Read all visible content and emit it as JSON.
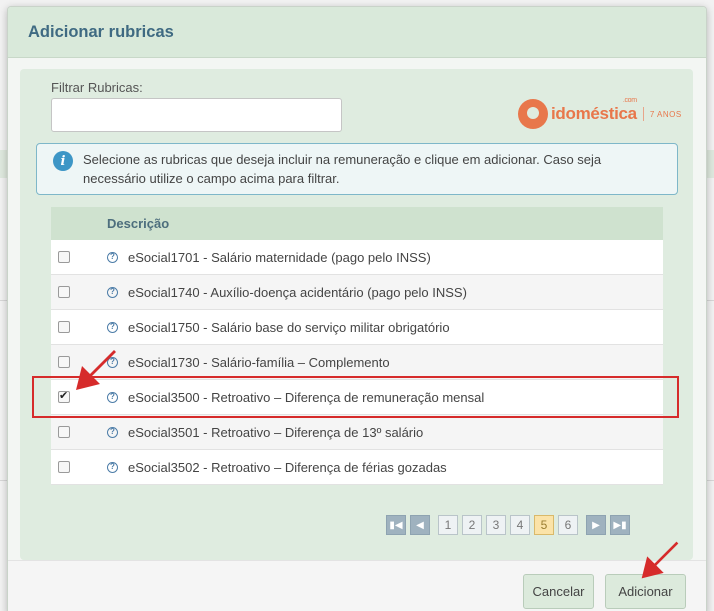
{
  "dialog": {
    "title": "Adicionar rubricas"
  },
  "filter": {
    "label": "Filtrar Rubricas:",
    "value": "",
    "placeholder": ""
  },
  "logo": {
    "brand": "idoméstica",
    "suffix": ".com",
    "tagline": "7 ANOS"
  },
  "info": {
    "message": "Selecione as rubricas que deseja incluir na remuneração e clique em adicionar. Caso seja necessário utilize o campo acima para filtrar."
  },
  "table": {
    "header": "Descrição",
    "rows": [
      {
        "label": "eSocial1701 - Salário maternidade (pago pelo INSS)",
        "checked": false
      },
      {
        "label": "eSocial1740 - Auxílio-doença acidentário (pago pelo INSS)",
        "checked": false
      },
      {
        "label": "eSocial1750 - Salário base do serviço militar obrigatório",
        "checked": false
      },
      {
        "label": "eSocial1730 - Salário-família – Complemento",
        "checked": false
      },
      {
        "label": "eSocial3500 - Retroativo – Diferença de remuneração mensal",
        "checked": true
      },
      {
        "label": "eSocial3501 - Retroativo – Diferença de 13º salário",
        "checked": false
      },
      {
        "label": "eSocial3502 - Retroativo – Diferença de férias gozadas",
        "checked": false
      }
    ]
  },
  "pagination": {
    "pages": [
      "1",
      "2",
      "3",
      "4",
      "5",
      "6"
    ],
    "current": "5"
  },
  "footer": {
    "cancel_label": "Cancelar",
    "add_label": "Adicionar"
  },
  "colors": {
    "accent": "#d62b2b",
    "header_bg": "#d9e9da",
    "logo": "#e8774b"
  }
}
